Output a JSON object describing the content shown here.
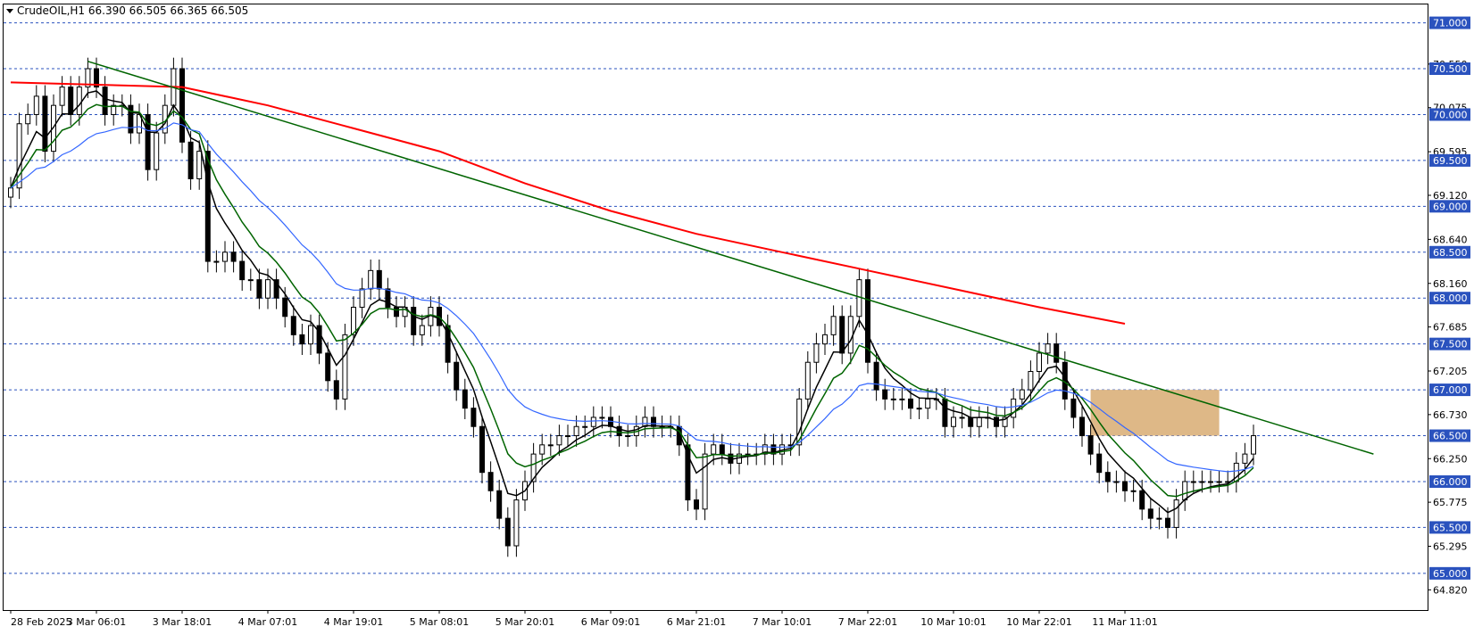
{
  "header": {
    "symbol_label": "CrudeOIL,H1  66.390 66.505 66.365 66.505"
  },
  "colors": {
    "ema_fast": "#000000",
    "ema_mid": "#006400",
    "ema_slow": "#3366ff",
    "ema_200": "#ff0000",
    "trendline": "#006400",
    "zone": "#deb887",
    "grid": "#2a52be",
    "price_tag": "#2a52be"
  },
  "chart_data": {
    "type": "candlestick",
    "y_range": [
      64.6,
      71.2
    ],
    "x_count": 160,
    "y_tick_labels": [
      "71.000",
      "70.550",
      "70.500",
      "70.075",
      "70.000",
      "69.595",
      "69.500",
      "69.120",
      "69.000",
      "68.640",
      "68.500",
      "68.160",
      "68.000",
      "67.685",
      "67.500",
      "67.205",
      "67.000",
      "66.730",
      "66.500",
      "66.250",
      "66.000",
      "65.775",
      "65.500",
      "65.295",
      "65.000",
      "64.820"
    ],
    "y_tick_values": [
      71.0,
      70.55,
      70.5,
      70.075,
      70.0,
      69.595,
      69.5,
      69.12,
      69.0,
      68.64,
      68.5,
      68.16,
      68.0,
      67.685,
      67.5,
      67.205,
      67.0,
      66.73,
      66.5,
      66.25,
      66.0,
      65.775,
      65.5,
      65.295,
      65.0,
      64.82
    ],
    "grid_levels": [
      71.0,
      70.5,
      70.0,
      69.5,
      69.0,
      68.5,
      68.0,
      67.5,
      67.0,
      66.5,
      66.0,
      65.5,
      65.0
    ],
    "highlighted_levels": [
      "71.000",
      "70.500",
      "70.000",
      "69.500",
      "69.000",
      "68.500",
      "68.000",
      "67.500",
      "67.000",
      "66.500",
      "66.000",
      "65.500",
      "65.000"
    ],
    "x_tick_labels": [
      "28 Feb 2025",
      "3 Mar 06:01",
      "3 Mar 18:01",
      "4 Mar 07:01",
      "4 Mar 19:01",
      "5 Mar 08:01",
      "5 Mar 20:01",
      "6 Mar 09:01",
      "6 Mar 21:01",
      "7 Mar 10:01",
      "7 Mar 22:01",
      "10 Mar 10:01",
      "10 Mar 22:01",
      "11 Mar 11:01"
    ],
    "x_tick_index": [
      0,
      10,
      20,
      30,
      40,
      50,
      60,
      70,
      80,
      90,
      100,
      110,
      120,
      130
    ],
    "closes": [
      69.2,
      69.9,
      70.0,
      70.2,
      69.6,
      70.1,
      70.3,
      70.0,
      70.3,
      70.5,
      70.3,
      70.0,
      70.1,
      70.1,
      69.8,
      70.0,
      69.4,
      69.8,
      70.1,
      70.5,
      69.7,
      69.3,
      69.6,
      68.4,
      68.4,
      68.5,
      68.4,
      68.2,
      68.2,
      68.0,
      68.2,
      68.0,
      67.8,
      67.6,
      67.5,
      67.7,
      67.4,
      67.1,
      66.9,
      67.6,
      67.9,
      68.1,
      68.3,
      68.1,
      67.9,
      67.8,
      67.9,
      67.6,
      67.7,
      67.9,
      67.7,
      67.3,
      67.0,
      66.8,
      66.6,
      66.1,
      65.9,
      65.6,
      65.3,
      65.8,
      66.0,
      66.3,
      66.4,
      66.4,
      66.5,
      66.5,
      66.6,
      66.6,
      66.7,
      66.7,
      66.6,
      66.5,
      66.5,
      66.6,
      66.7,
      66.6,
      66.6,
      66.6,
      66.4,
      65.8,
      65.7,
      66.3,
      66.4,
      66.3,
      66.2,
      66.3,
      66.3,
      66.3,
      66.4,
      66.3,
      66.4,
      66.4,
      66.9,
      67.3,
      67.5,
      67.6,
      67.8,
      67.4,
      67.8,
      68.2,
      67.3,
      67.0,
      66.9,
      66.9,
      66.9,
      66.8,
      66.8,
      66.9,
      66.9,
      66.6,
      66.7,
      66.7,
      66.6,
      66.7,
      66.7,
      66.6,
      66.7,
      66.9,
      67.0,
      67.2,
      67.4,
      67.5,
      67.3,
      66.9,
      66.7,
      66.5,
      66.3,
      66.1,
      66.0,
      66.0,
      65.9,
      65.9,
      65.7,
      65.6,
      65.6,
      65.5,
      65.8,
      66.0,
      66.0,
      66.0,
      66.0,
      66.0,
      66.0,
      66.2,
      66.3,
      66.5
    ],
    "ema_fast_end": 66.2,
    "ema_mid_end": 66.2,
    "ema_slow_end": 66.5,
    "ema_200_points": [
      [
        0,
        70.35
      ],
      [
        20,
        70.3
      ],
      [
        30,
        70.1
      ],
      [
        40,
        69.85
      ],
      [
        50,
        69.6
      ],
      [
        60,
        69.25
      ],
      [
        70,
        68.95
      ],
      [
        80,
        68.7
      ],
      [
        90,
        68.5
      ],
      [
        100,
        68.3
      ],
      [
        110,
        68.1
      ],
      [
        120,
        67.9
      ],
      [
        130,
        67.72
      ]
    ],
    "trendline": {
      "start": [
        9,
        70.58
      ],
      "end": [
        159,
        66.3
      ]
    },
    "zone": {
      "x_start": 126,
      "x_end": 141,
      "y_low": 66.5,
      "y_high": 67.0
    }
  }
}
